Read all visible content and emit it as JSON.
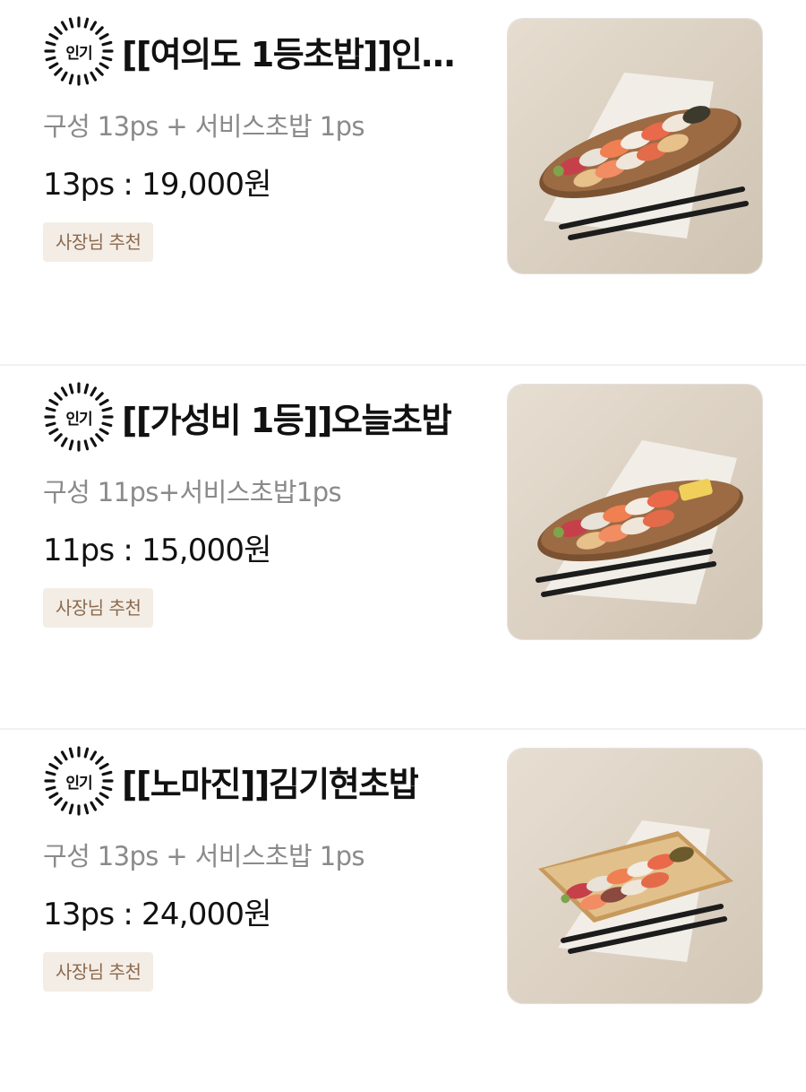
{
  "colors": {
    "badge_bg": "#f3ede6",
    "badge_text": "#8c6a4d",
    "desc_text": "#8a8a8a",
    "title_text": "#111111",
    "photo_bg": "#dcd2c4"
  },
  "menu": {
    "items": [
      {
        "popular_label": "인기",
        "title": "[[여의도 1등초밥]]인…",
        "desc": "구성 13ps + 서비스초밥 1ps",
        "price": "13ps : 19,000원",
        "badge": "사장님 추천",
        "image_icon": "sushi-platter-oval-board"
      },
      {
        "popular_label": "인기",
        "title": "[[가성비 1등]]오늘초밥",
        "desc": "구성 11ps+서비스초밥1ps",
        "price": "11ps : 15,000원",
        "badge": "사장님 추천",
        "image_icon": "sushi-platter-oval-board"
      },
      {
        "popular_label": "인기",
        "title": "[[노마진]]김기현초밥",
        "desc": "구성 13ps + 서비스초밥 1ps",
        "price": "13ps : 24,000원",
        "badge": "사장님 추천",
        "image_icon": "sushi-platter-square-tray"
      }
    ]
  }
}
